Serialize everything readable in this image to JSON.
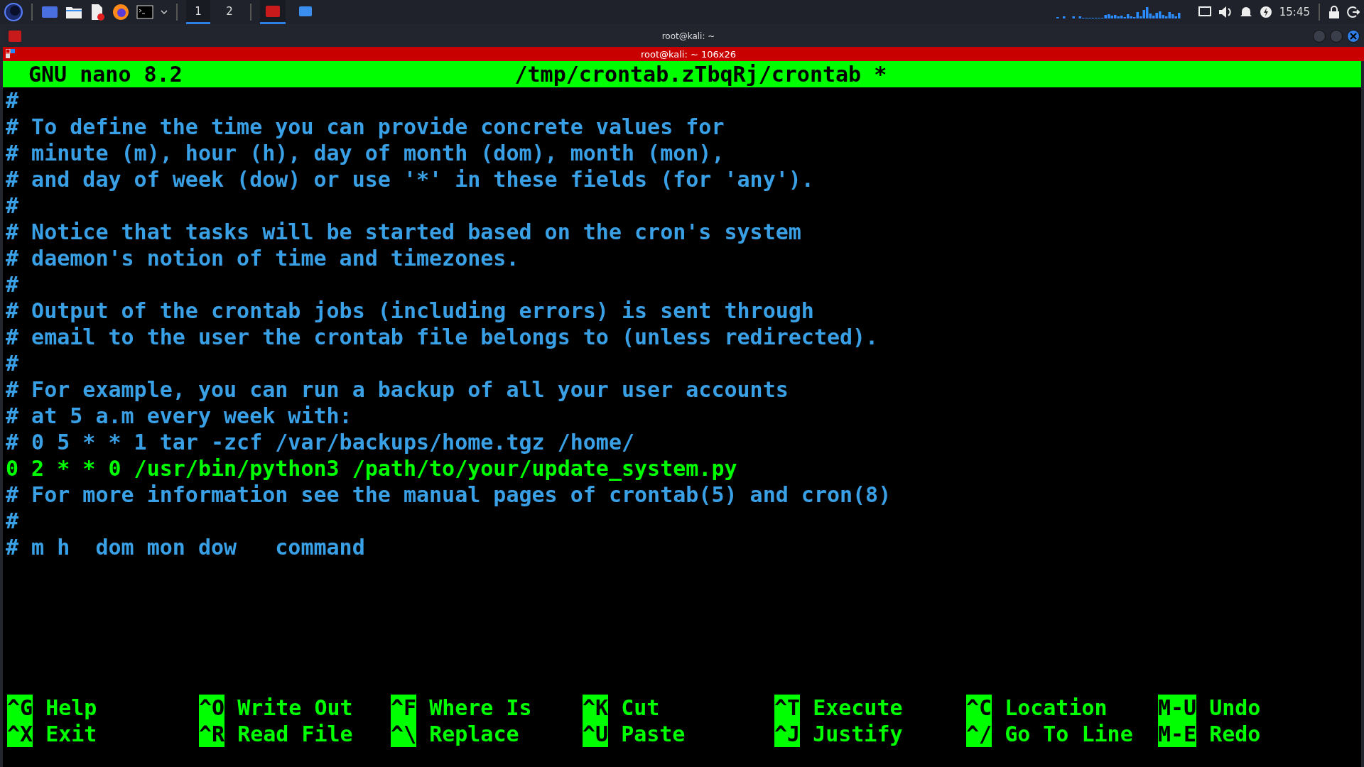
{
  "taskbar": {
    "workspaces": [
      {
        "label": "1",
        "selected": true
      },
      {
        "label": "2",
        "selected": false
      }
    ],
    "clock": "15:45"
  },
  "window": {
    "title": "root@kali: ~",
    "terminal_title": "root@kali: ~ 106x26"
  },
  "nano": {
    "version": "GNU nano 8.2",
    "filename": "/tmp/crontab.zTbqRj/crontab *",
    "lines": [
      {
        "kind": "comment",
        "text": "#"
      },
      {
        "kind": "comment",
        "text": "# To define the time you can provide concrete values for"
      },
      {
        "kind": "comment",
        "text": "# minute (m), hour (h), day of month (dom), month (mon),"
      },
      {
        "kind": "comment",
        "text": "# and day of week (dow) or use '*' in these fields (for 'any')."
      },
      {
        "kind": "comment",
        "text": "#"
      },
      {
        "kind": "comment",
        "text": "# Notice that tasks will be started based on the cron's system"
      },
      {
        "kind": "comment",
        "text": "# daemon's notion of time and timezones."
      },
      {
        "kind": "comment",
        "text": "#"
      },
      {
        "kind": "comment",
        "text": "# Output of the crontab jobs (including errors) is sent through"
      },
      {
        "kind": "comment",
        "text": "# email to the user the crontab file belongs to (unless redirected)."
      },
      {
        "kind": "comment",
        "text": "#"
      },
      {
        "kind": "comment",
        "text": "# For example, you can run a backup of all your user accounts"
      },
      {
        "kind": "comment",
        "text": "# at 5 a.m every week with:"
      },
      {
        "kind": "comment",
        "text": "# 0 5 * * 1 tar -zcf /var/backups/home.tgz /home/"
      },
      {
        "kind": "command",
        "text": "0 2 * * 0 /usr/bin/python3 /path/to/your/update_system.py"
      },
      {
        "kind": "comment",
        "text": "# For more information see the manual pages of crontab(5) and cron(8)"
      },
      {
        "kind": "comment",
        "text": "#"
      },
      {
        "kind": "comment",
        "text": "# m h  dom mon dow   command"
      }
    ],
    "shortcuts": [
      [
        {
          "key": "^G",
          "label": "Help"
        },
        {
          "key": "^X",
          "label": "Exit"
        }
      ],
      [
        {
          "key": "^O",
          "label": "Write Out"
        },
        {
          "key": "^R",
          "label": "Read File"
        }
      ],
      [
        {
          "key": "^F",
          "label": "Where Is"
        },
        {
          "key": "^\\",
          "label": "Replace"
        }
      ],
      [
        {
          "key": "^K",
          "label": "Cut"
        },
        {
          "key": "^U",
          "label": "Paste"
        }
      ],
      [
        {
          "key": "^T",
          "label": "Execute"
        },
        {
          "key": "^J",
          "label": "Justify"
        }
      ],
      [
        {
          "key": "^C",
          "label": "Location"
        },
        {
          "key": "^/",
          "label": "Go To Line"
        }
      ],
      [
        {
          "key": "M-U",
          "label": "Undo"
        },
        {
          "key": "M-E",
          "label": "Redo"
        }
      ]
    ]
  }
}
